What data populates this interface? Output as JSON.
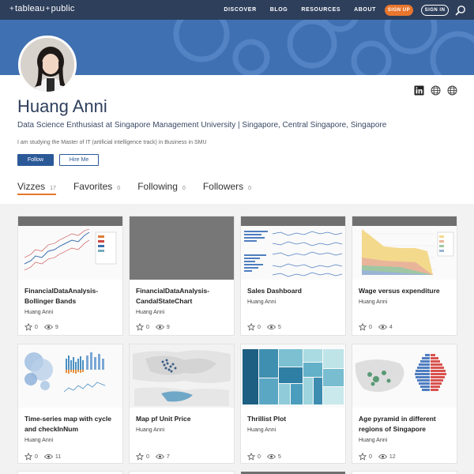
{
  "nav": {
    "logo_left": "tableau",
    "logo_right": "public",
    "links": [
      "DISCOVER",
      "BLOG",
      "RESOURCES",
      "ABOUT"
    ],
    "signup_label": "SIGN UP",
    "signin_label": "SIGN IN",
    "icons": {
      "search": "search-icon"
    }
  },
  "colors": {
    "nav_bg": "#2e3f5c",
    "banner_bg": "#3f70b2",
    "accent": "#e8762d",
    "button_blue": "#2b5998"
  },
  "profile": {
    "name": "Huang Anni",
    "headline": "Data Science Enthusiast at Singapore Management University | Singapore, Central Singapore, Singapore",
    "bio": "I am studying the Master of IT (artificial intelligence track) in Business in SMU",
    "follow_label": "Follow",
    "hire_label": "Hire Me",
    "social_icons": [
      "linkedin-icon",
      "globe-icon",
      "globe-icon"
    ]
  },
  "tabs": [
    {
      "label": "Vizzes",
      "count": "17"
    },
    {
      "label": "Favorites",
      "count": "0"
    },
    {
      "label": "Following",
      "count": "0"
    },
    {
      "label": "Followers",
      "count": "0"
    }
  ],
  "cards": [
    {
      "title": "FinancialDataAnalysis-Bollinger Bands",
      "author": "Huang Anni",
      "favorites": "0",
      "views": "9"
    },
    {
      "title": "FinancialDataAnalysis-CandalStateChart",
      "author": "Huang Anni",
      "favorites": "0",
      "views": "9"
    },
    {
      "title": "Sales Dashboard",
      "author": "Huang Anni",
      "favorites": "0",
      "views": "5"
    },
    {
      "title": "Wage versus expenditure",
      "author": "Huang Anni",
      "favorites": "0",
      "views": "4"
    },
    {
      "title": "Time-series map with cycle and checkInNum",
      "author": "Huang Anni",
      "favorites": "0",
      "views": "11"
    },
    {
      "title": "Map pf Unit Price",
      "author": "Huang Anni",
      "favorites": "0",
      "views": "7"
    },
    {
      "title": "Thrillist Plot",
      "author": "Huang Anni",
      "favorites": "0",
      "views": "5"
    },
    {
      "title": "Age pyramid in different regions of Singapore",
      "author": "Huang Anni",
      "favorites": "0",
      "views": "12"
    }
  ]
}
